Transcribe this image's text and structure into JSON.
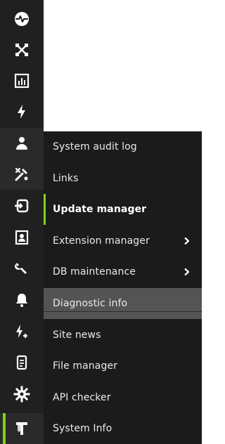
{
  "rail": {
    "items": [
      {
        "name": "activity-icon"
      },
      {
        "name": "network-icon"
      },
      {
        "name": "chart-icon"
      },
      {
        "name": "bolt-icon"
      },
      {
        "name": "user-icon"
      },
      {
        "name": "tools-icon"
      },
      {
        "name": "login-icon"
      },
      {
        "name": "contact-card-icon"
      },
      {
        "name": "wrench-icon"
      },
      {
        "name": "bell-icon"
      },
      {
        "name": "bolt-plus-icon"
      },
      {
        "name": "document-icon"
      },
      {
        "name": "gear-icon"
      },
      {
        "name": "system-tool-icon"
      }
    ]
  },
  "menu": {
    "items": [
      {
        "label": "System audit log"
      },
      {
        "label": "Links"
      },
      {
        "label": "Update manager"
      },
      {
        "label": "Extension manager"
      },
      {
        "label": "DB maintenance"
      },
      {
        "label": "Diagnostic info"
      },
      {
        "label": "Site news"
      },
      {
        "label": "File manager"
      },
      {
        "label": "API checker"
      },
      {
        "label": "System Info"
      }
    ]
  },
  "colors": {
    "rail_bg": "#202020",
    "menu_bg": "#1b1b1b",
    "menu_hover_bg": "#545454",
    "accent": "#7fd11b",
    "text": "#eaeaea"
  }
}
